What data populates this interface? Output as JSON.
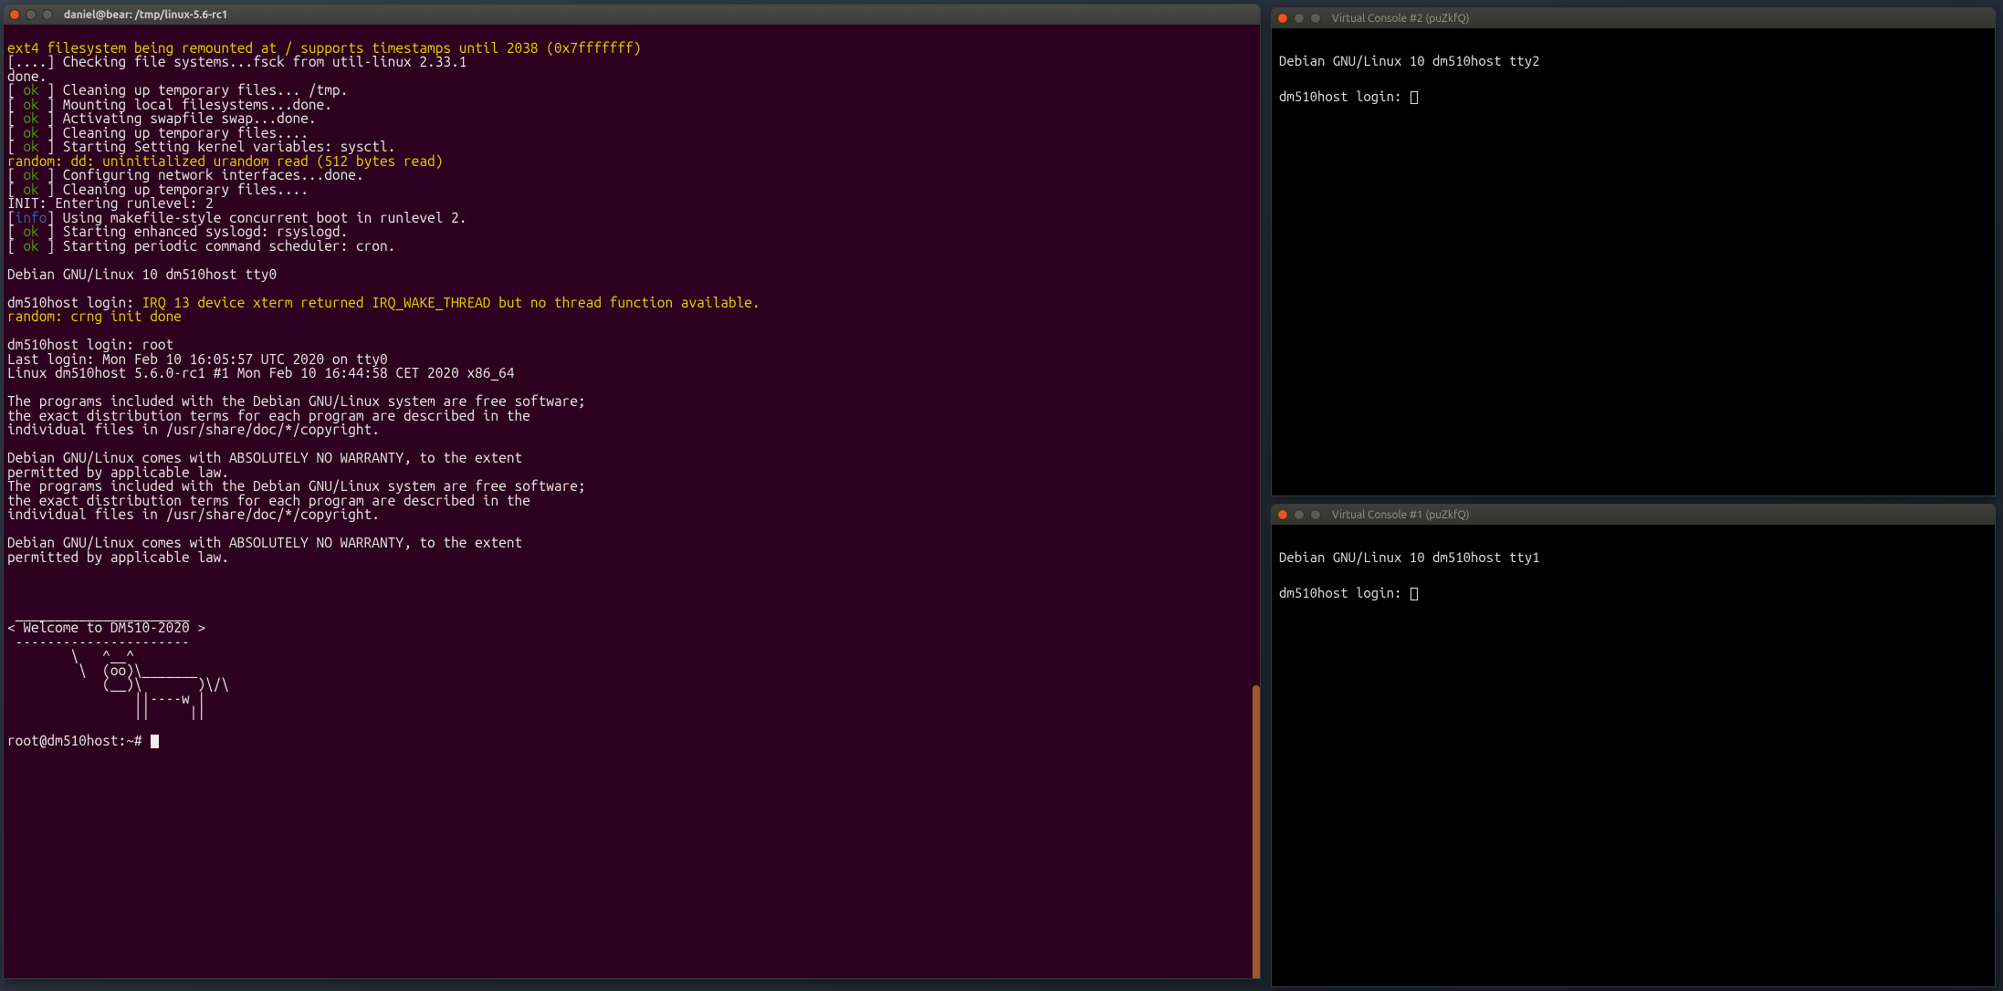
{
  "colors": {
    "main_bg": "#2c001e",
    "main_fg": "#eeeeec",
    "vc_bg": "#000000",
    "vc_fg": "#e6e6e6",
    "ok": "#4e9a06",
    "info": "#3465a4",
    "kern": "#edd400",
    "close_btn": "#e95420"
  },
  "main": {
    "title": "daniel@bear: /tmp/linux-5.6-rc1",
    "lines": [
      {
        "prefix": "",
        "text": "ext4 filesystem being remounted at / supports timestamps until 2038 (0x7fffffff)",
        "kern": true
      },
      {
        "prefix": "[....]",
        "text": "Checking file systems...fsck from util-linux 2.33.1"
      },
      {
        "prefix": "",
        "text": "done."
      },
      {
        "prefix": "[ ok ]",
        "ok": true,
        "text": "Cleaning up temporary files... /tmp."
      },
      {
        "prefix": "[ ok ]",
        "ok": true,
        "text": "Mounting local filesystems...done."
      },
      {
        "prefix": "[ ok ]",
        "ok": true,
        "text": "Activating swapfile swap...done."
      },
      {
        "prefix": "[ ok ]",
        "ok": true,
        "text": "Cleaning up temporary files...."
      },
      {
        "prefix": "[ ok ]",
        "ok": true,
        "text": "Starting Setting kernel variables: sysctl."
      },
      {
        "prefix": "",
        "text": "random: dd: uninitialized urandom read (512 bytes read)",
        "kern": true
      },
      {
        "prefix": "[ ok ]",
        "ok": true,
        "text": "Configuring network interfaces...done."
      },
      {
        "prefix": "[ ok ]",
        "ok": true,
        "text": "Cleaning up temporary files...."
      },
      {
        "prefix": "",
        "text": "INIT: Entering runlevel: 2"
      },
      {
        "prefix": "[info]",
        "info": true,
        "text": "Using makefile-style concurrent boot in runlevel 2."
      },
      {
        "prefix": "[ ok ]",
        "ok": true,
        "text": "Starting enhanced syslogd: rsyslogd."
      },
      {
        "prefix": "[ ok ]",
        "ok": true,
        "text": "Starting periodic command scheduler: cron."
      },
      {
        "prefix": "",
        "text": ""
      },
      {
        "prefix": "",
        "text": "Debian GNU/Linux 10 dm510host tty0"
      },
      {
        "prefix": "",
        "text": ""
      },
      {
        "prefix": "",
        "text": "dm510host login: IRQ 13 device xterm returned IRQ_WAKE_THREAD but no thread function available.",
        "kern_tail": "IRQ 13 device xterm returned IRQ_WAKE_THREAD but no thread function available.",
        "plain_head": "dm510host login: "
      },
      {
        "prefix": "",
        "text": "random: crng init done",
        "kern": true
      },
      {
        "prefix": "",
        "text": ""
      },
      {
        "prefix": "",
        "text": "dm510host login: root"
      },
      {
        "prefix": "",
        "text": "Last login: Mon Feb 10 16:05:57 UTC 2020 on tty0"
      },
      {
        "prefix": "",
        "text": "Linux dm510host 5.6.0-rc1 #1 Mon Feb 10 16:44:58 CET 2020 x86_64"
      },
      {
        "prefix": "",
        "text": ""
      },
      {
        "prefix": "",
        "text": "The programs included with the Debian GNU/Linux system are free software;"
      },
      {
        "prefix": "",
        "text": "the exact distribution terms for each program are described in the"
      },
      {
        "prefix": "",
        "text": "individual files in /usr/share/doc/*/copyright."
      },
      {
        "prefix": "",
        "text": ""
      },
      {
        "prefix": "",
        "text": "Debian GNU/Linux comes with ABSOLUTELY NO WARRANTY, to the extent"
      },
      {
        "prefix": "",
        "text": "permitted by applicable law."
      },
      {
        "prefix": "",
        "text": "The programs included with the Debian GNU/Linux system are free software;"
      },
      {
        "prefix": "",
        "text": "the exact distribution terms for each program are described in the"
      },
      {
        "prefix": "",
        "text": "individual files in /usr/share/doc/*/copyright."
      },
      {
        "prefix": "",
        "text": ""
      },
      {
        "prefix": "",
        "text": "Debian GNU/Linux comes with ABSOLUTELY NO WARRANTY, to the extent"
      },
      {
        "prefix": "",
        "text": "permitted by applicable law."
      }
    ],
    "motd": [
      " ______________________ ",
      "< Welcome to DM510-2020 >",
      " ---------------------- ",
      "        \\   ^__^",
      "         \\  (oo)\\_______",
      "            (__)\\       )\\/\\",
      "                ||----w |",
      "                ||     ||"
    ],
    "prompt": "root@dm510host:~# "
  },
  "vc2": {
    "title": "Virtual Console #2 (puZkfQ)",
    "banner": "Debian GNU/Linux 10 dm510host tty2",
    "login": "dm510host login: "
  },
  "vc1": {
    "title": "Virtual Console #1 (puZkfQ)",
    "banner": "Debian GNU/Linux 10 dm510host tty1",
    "login": "dm510host login: "
  }
}
